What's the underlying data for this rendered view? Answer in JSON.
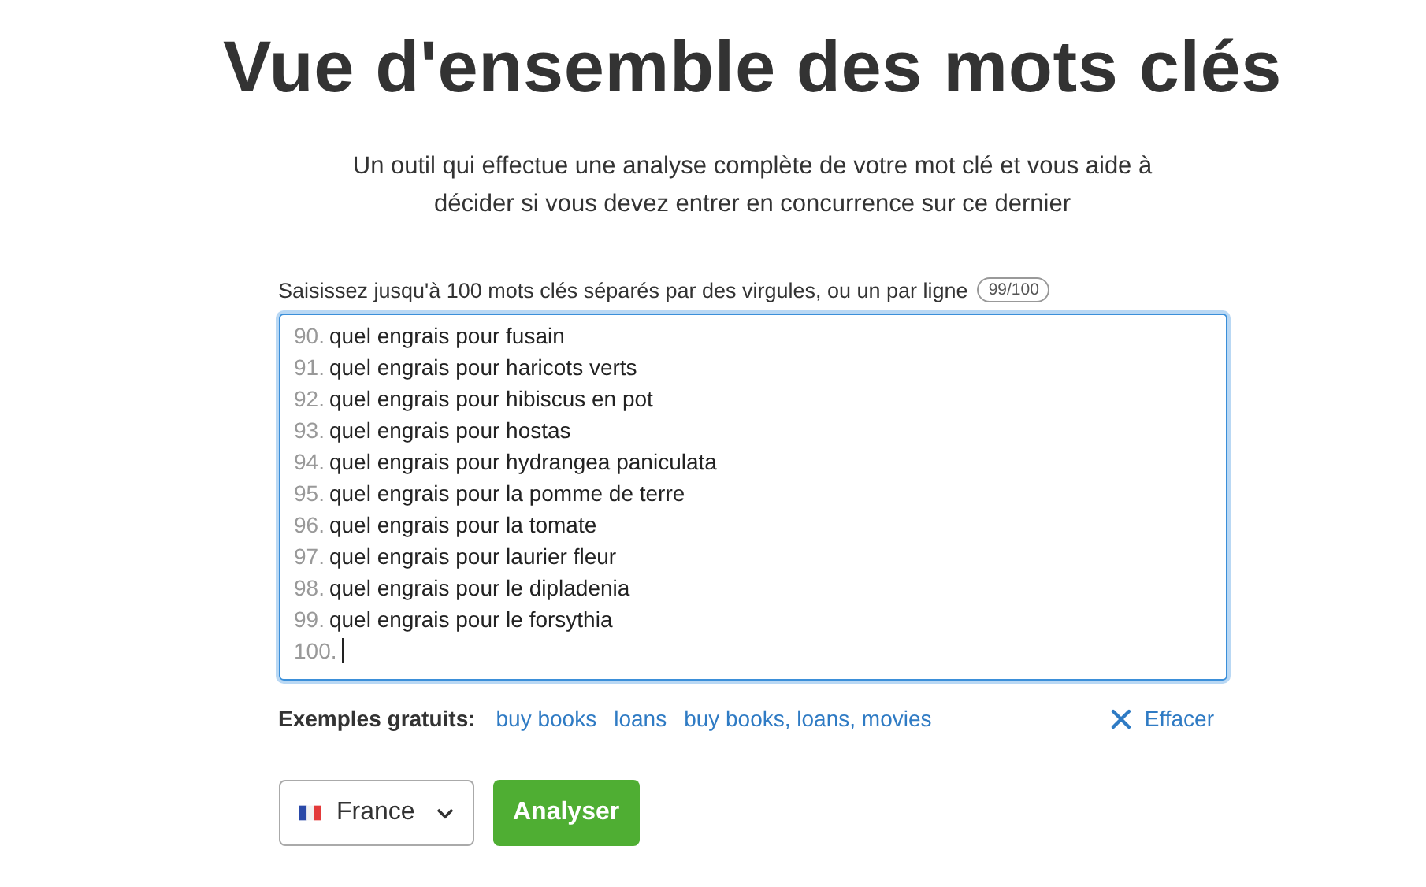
{
  "title": "Vue d'ensemble des mots clés",
  "subtitle": "Un outil qui effectue une analyse complète de votre mot clé et vous aide à décider si vous devez entrer en concurrence sur ce dernier",
  "input": {
    "label": "Saisissez jusqu'à 100 mots clés séparés par des virgules, ou un par ligne",
    "counter": "99/100",
    "lines": [
      {
        "number": "90.",
        "text": "quel engrais pour fusain"
      },
      {
        "number": "91.",
        "text": "quel engrais pour haricots verts"
      },
      {
        "number": "92.",
        "text": "quel engrais pour hibiscus en pot"
      },
      {
        "number": "93.",
        "text": "quel engrais pour hostas"
      },
      {
        "number": "94.",
        "text": "quel engrais pour hydrangea paniculata"
      },
      {
        "number": "95.",
        "text": "quel engrais pour la pomme de terre"
      },
      {
        "number": "96.",
        "text": "quel engrais pour la tomate"
      },
      {
        "number": "97.",
        "text": "quel engrais pour laurier fleur"
      },
      {
        "number": "98.",
        "text": "quel engrais pour le dipladenia"
      },
      {
        "number": "99.",
        "text": "quel engrais pour le forsythia"
      },
      {
        "number": "100.",
        "cursor": true
      }
    ]
  },
  "examples": {
    "label": "Exemples gratuits:",
    "links": [
      "buy books",
      "loans",
      "buy books, loans, movies"
    ]
  },
  "clear": "Effacer",
  "country": "France",
  "submit": "Analyser"
}
